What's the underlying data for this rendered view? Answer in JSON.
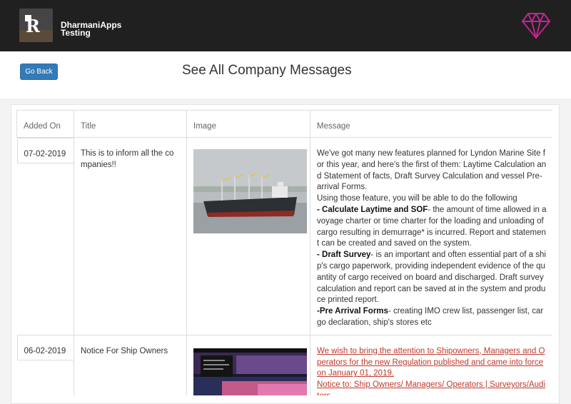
{
  "app": {
    "brand_line1": "DharmaniApps",
    "brand_line2": "Testing"
  },
  "toolbar": {
    "back_label": "Go Back"
  },
  "page": {
    "title": "See All Company Messages"
  },
  "table": {
    "headers": {
      "added_on": "Added On",
      "title": "Title",
      "image": "Image",
      "message": "Message"
    },
    "rows": [
      {
        "date": "07-02-2019",
        "title": "This is to inform all the companies!!",
        "image": "cargo-ship-photo",
        "message": {
          "intro": "We've got many new features planned for Lyndon Marine Site for this year, and here's the first of them: Laytime Calculation and Statement of facts, Draft Survey Calculation and vessel Pre-arrival Forms.",
          "line2": "Using those feature, you will be able to do the following",
          "item1_bold": "- Calculate Laytime and SOF",
          "item1_text": "- the amount of time allowed in a voyage charter or time charter for the loading and unloading of cargo resulting in demurrage* is incurred. Report and statement can be created and saved on the system.",
          "item2_bold": "- Draft Survey",
          "item2_text": "- is an important and often essential part of a ship's cargo paperwork, providing independent evidence of the quantity of cargo received on board and discharged. Draft survey calculation and report can be saved at in the system and produce printed report.",
          "item3_bold": "-Pre Arrival Forms",
          "item3_text": "- creating IMO crew list, passenger list, cargo declaration, ship's stores etc"
        }
      },
      {
        "date": "06-02-2019",
        "title": "Notice For Ship Owners",
        "image": "website-screenshot",
        "message": {
          "link1": "We wish to bring the attention to Shipowners, Managers and Operators for the new Regulation published and came into force on January 01, 2019.",
          "link2": "Notice to: Ship Owners/ Managers/ Operators | Surveyors/Auditors"
        }
      }
    ]
  },
  "colors": {
    "topbar": "#202020",
    "button": "#337ab7",
    "link": "#c0392b",
    "gem": "#c0268f"
  }
}
